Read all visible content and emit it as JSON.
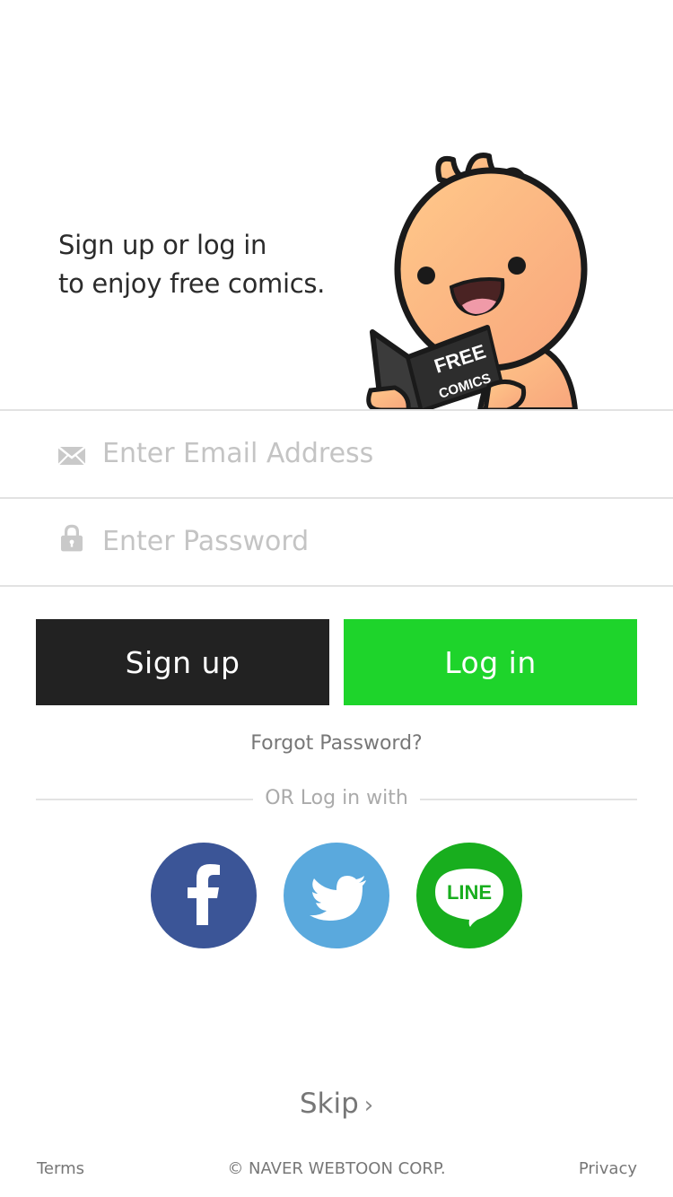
{
  "hero": {
    "tagline_line1": "Sign up or log in",
    "tagline_line2": "to enjoy free comics.",
    "book_text_line1": "FREE",
    "book_text_line2": "COMICS"
  },
  "form": {
    "email_placeholder": "Enter Email Address",
    "password_placeholder": "Enter Password",
    "email_icon": "envelope-icon",
    "password_icon": "lock-icon"
  },
  "buttons": {
    "signup_label": "Sign up",
    "login_label": "Log in",
    "forgot_password": "Forgot Password?"
  },
  "social": {
    "divider_text": "OR Log in with",
    "providers": [
      {
        "name": "facebook",
        "glyph": "f",
        "color": "#3b5597"
      },
      {
        "name": "twitter",
        "color": "#5aa9dd"
      },
      {
        "name": "line",
        "glyph": "LINE",
        "color": "#18ae1e"
      }
    ]
  },
  "skip": {
    "label": "Skip",
    "chevron": "›"
  },
  "footer": {
    "terms": "Terms",
    "copyright": "© NAVER WEBTOON  CORP.",
    "privacy": "Privacy"
  },
  "colors": {
    "signup_bg": "#222222",
    "login_bg": "#1ed42b",
    "placeholder": "#c4c4c4"
  }
}
